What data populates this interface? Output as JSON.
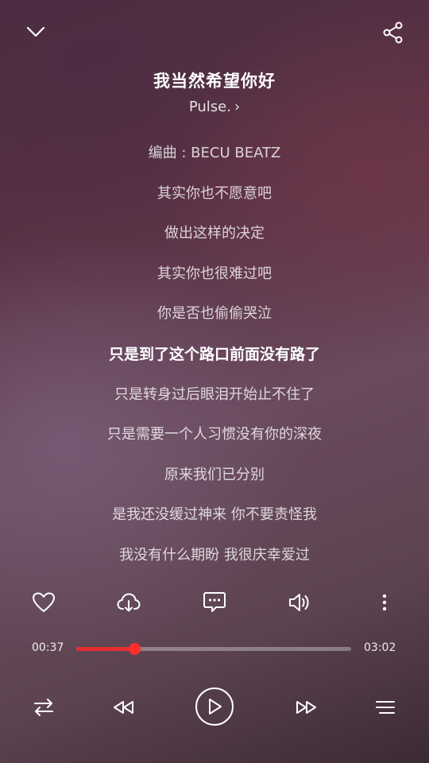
{
  "header": {
    "collapse_icon": "chevron-down-icon",
    "share_icon": "share-icon"
  },
  "song": {
    "title": "我当然希望你好",
    "artist": "Pulse.",
    "artist_chevron": "›"
  },
  "lyrics": {
    "active_index": 5,
    "lines": [
      "编曲 : BECU BEATZ",
      "其实你也不愿意吧",
      "做出这样的决定",
      "其实你也很难过吧",
      "你是否也偷偷哭泣",
      "只是到了这个路口前面没有路了",
      "只是转身过后眼泪开始止不住了",
      "只是需要一个人习惯没有你的深夜",
      "原来我们已分别",
      "是我还没缓过神来 你不要责怪我",
      "我没有什么期盼 我很庆幸爱过"
    ]
  },
  "actions": [
    "heart-icon",
    "download-icon",
    "comment-icon",
    "volume-icon",
    "more-icon"
  ],
  "playback": {
    "current_time": "00:37",
    "total_time": "03:02",
    "progress_fraction": 0.21,
    "progress_color": "#e62e2e"
  },
  "controls": [
    "repeat-icon",
    "previous-icon",
    "play-icon",
    "next-icon",
    "playlist-icon"
  ]
}
